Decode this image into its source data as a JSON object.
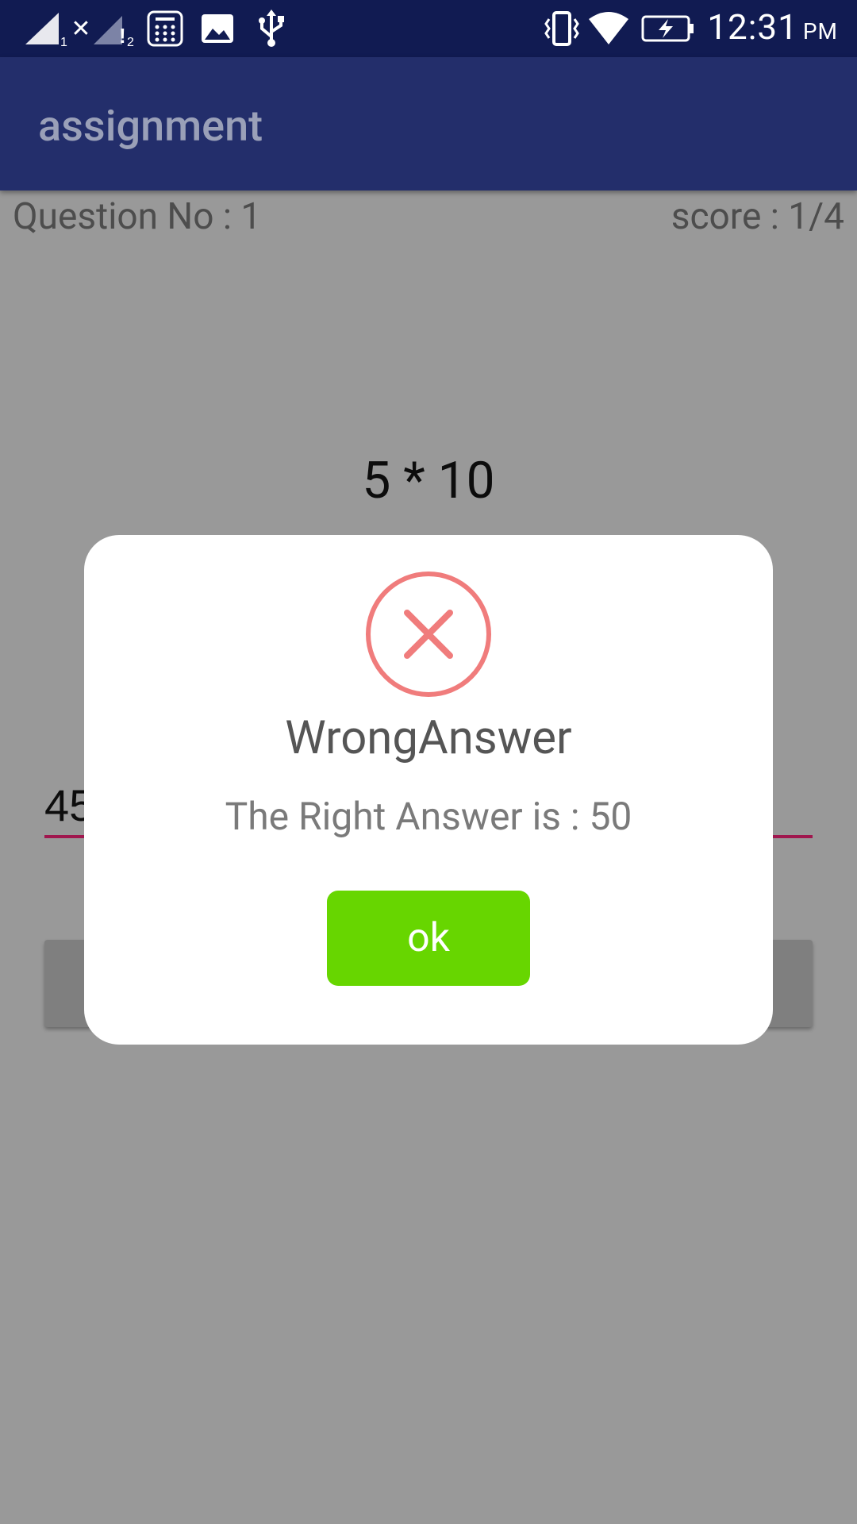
{
  "status_bar": {
    "time": "12:31",
    "ampm": "PM",
    "icons": [
      "signal-1-icon",
      "signal-2-icon",
      "calculator-icon",
      "image-icon",
      "usb-icon",
      "vibrate-icon",
      "wifi-icon",
      "battery-charging-icon"
    ],
    "sim1_sub": "1",
    "sim2_sub": "2"
  },
  "app_bar": {
    "title": "assignment"
  },
  "quiz": {
    "question_number": "Question No : 1",
    "score": "score : 1/4",
    "question": "5 * 10",
    "answer_value": "45"
  },
  "dialog": {
    "icon": "error-x-icon",
    "title": "WrongAnswer",
    "message": "The Right Answer is : 50",
    "ok_label": "ok"
  },
  "colors": {
    "status_bar": "#111b52",
    "app_bar": "#232e6b",
    "scrim": "#999999",
    "error": "#f07c7c",
    "ok_button": "#67d600",
    "input_underline": "#a0174e"
  }
}
